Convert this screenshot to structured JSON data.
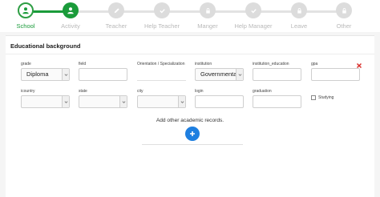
{
  "stepper": {
    "steps": [
      {
        "label": "School",
        "state": "done",
        "icon": "user-icon"
      },
      {
        "label": "Activity",
        "state": "active",
        "icon": "user-icon"
      },
      {
        "label": "Teacher",
        "state": "pending",
        "icon": "edit-icon"
      },
      {
        "label": "Help Teacher",
        "state": "pending",
        "icon": "check-icon"
      },
      {
        "label": "Manger",
        "state": "pending",
        "icon": "lock-icon"
      },
      {
        "label": "Help Manager",
        "state": "pending",
        "icon": "check-icon"
      },
      {
        "label": "Leave",
        "state": "pending",
        "icon": "lock-icon"
      },
      {
        "label": "Other",
        "state": "pending",
        "icon": "lock-icon"
      }
    ],
    "colors": {
      "green": "#1a9b3a",
      "pending": "#dcdcdc"
    }
  },
  "section": {
    "title": "Educational background"
  },
  "fields": {
    "grade": {
      "label": "grade",
      "value": "Diploma"
    },
    "field": {
      "label": "field",
      "value": ""
    },
    "orientation": {
      "label": "Orientation / Specialization",
      "value": ""
    },
    "institution": {
      "label": "institution",
      "value": "Governmental"
    },
    "institution_education": {
      "label": "institution_education",
      "value": ""
    },
    "gpa": {
      "label": "gpa",
      "value": ""
    },
    "country": {
      "label": "icountry",
      "value": ""
    },
    "state": {
      "label": "state",
      "value": ""
    },
    "city": {
      "label": "city",
      "value": ""
    },
    "login": {
      "label": "login",
      "value": ""
    },
    "graduation": {
      "label": "graduation",
      "value": ""
    },
    "studying": {
      "label": "Studying",
      "checked": false
    }
  },
  "actions": {
    "add_text": "Add other academic records.",
    "add_icon": "plus-icon",
    "remove_icon": "close-icon",
    "accent": "#1e7fe0",
    "remove_color": "#d9302c"
  }
}
